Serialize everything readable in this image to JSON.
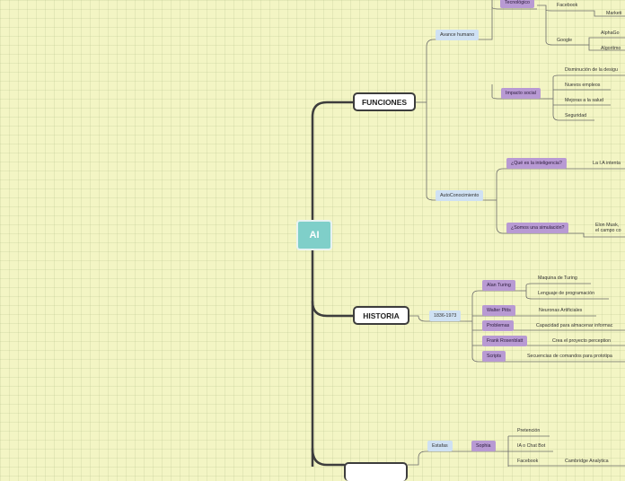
{
  "root": {
    "label": "AI"
  },
  "funciones": {
    "label": "FUNCIONES",
    "avance_humano": {
      "label": "Avance humano",
      "tecnologico": "Tecnológico",
      "facebook": "Facebook",
      "marketing": "Marketi",
      "google": "Google",
      "alphago": "AlphaGo",
      "algoritmo": "Algoritmo"
    },
    "impacto_social": {
      "label": "Impacto social",
      "items": [
        "Disminución de la desigu",
        "Nuevos empleos",
        "Mejoras a la salud",
        "Seguridad"
      ]
    },
    "autoconocimiento": {
      "label": "AutoConocimiento",
      "inteligencia": {
        "label": "¿Qué es la inteligencia?",
        "leaf": "La I.A intenta"
      },
      "simulacion": {
        "label": "¿Somos una simulación?",
        "leaf1": "Elon Musk,",
        "leaf2": "el campo co"
      }
    }
  },
  "historia": {
    "label": "HISTORIA",
    "period": "1836-1973",
    "rows": [
      {
        "label": "Alan Turing",
        "leaves": [
          "Maquina de Turing",
          "Lenguaje de programación"
        ]
      },
      {
        "label": "Walter Pitts",
        "leaves": [
          "Neuronas Artificiales"
        ]
      },
      {
        "label": "Problemas",
        "leaves": [
          "Capacidad para almacenar informac"
        ]
      },
      {
        "label": "Frank Rosenblatt",
        "leaves": [
          "Crea el proyecto perception"
        ]
      },
      {
        "label": "Scripts",
        "leaves": [
          "Secuencias de comandos para prototipa"
        ]
      }
    ]
  },
  "bottom": {
    "estafas": "Estafas",
    "sophia": "Sophia",
    "pretencion": "Pretención",
    "chatbot": "IA o Chat Bot",
    "facebook": "Facebook",
    "cambridge": "Cambridge Analytica"
  },
  "colors": {
    "background": "#f3f5c4",
    "root": "#7fcfc9",
    "connector": "#3d3d3d",
    "blue_tag": "#cfe1f3",
    "purple_tag": "#b89ad3"
  }
}
